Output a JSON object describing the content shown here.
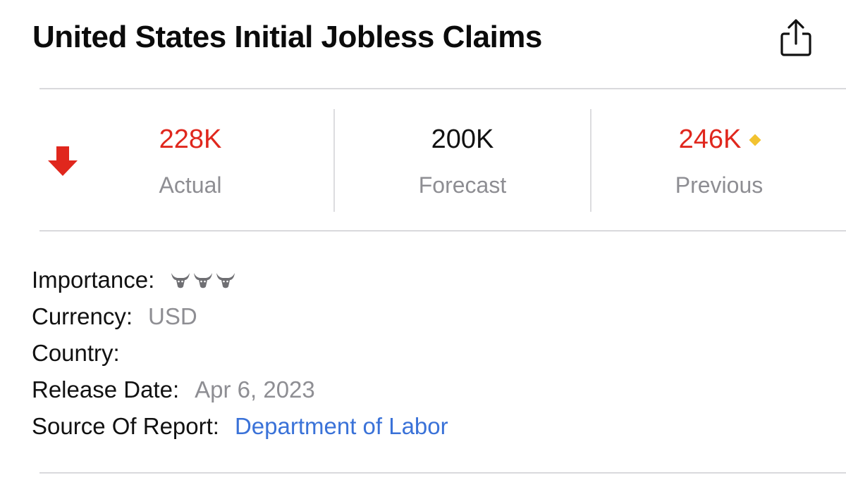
{
  "header": {
    "title": "United States Initial Jobless Claims",
    "share_icon": "share-icon"
  },
  "metrics": {
    "trend_icon": "arrow-down-icon",
    "trend_color": "#e0271d",
    "actual": {
      "value": "228K",
      "label": "Actual",
      "color": "#e0271d"
    },
    "forecast": {
      "value": "200K",
      "label": "Forecast",
      "color": "#111111"
    },
    "previous": {
      "value": "246K",
      "label": "Previous",
      "color": "#e0271d",
      "revised_marker_color": "#f2c230"
    }
  },
  "details": {
    "importance": {
      "label": "Importance:",
      "level": 3,
      "max": 3,
      "icon": "bull-icon"
    },
    "currency": {
      "label": "Currency:",
      "value": "USD"
    },
    "country": {
      "label": "Country:",
      "value": ""
    },
    "release_date": {
      "label": "Release Date:",
      "value": "Apr 6, 2023"
    },
    "source": {
      "label": "Source Of Report:",
      "value": "Department of Labor"
    }
  }
}
